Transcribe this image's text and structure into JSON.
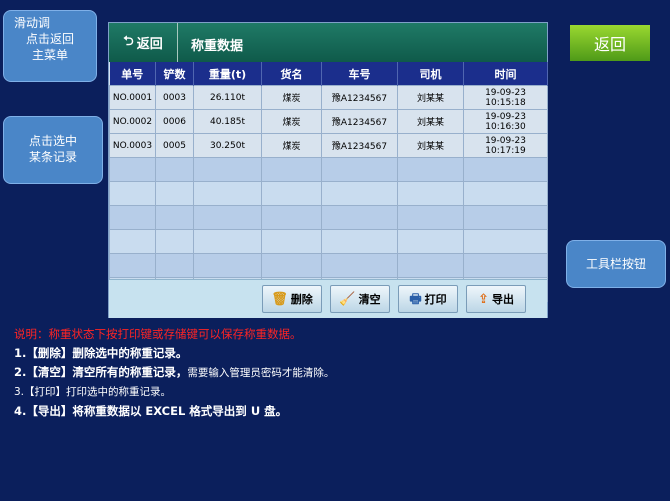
{
  "header": {
    "back_label": "返回",
    "title": "称重数据"
  },
  "right_button": {
    "label": "返回"
  },
  "table": {
    "columns": [
      "单号",
      "铲数",
      "重量(t)",
      "货名",
      "车号",
      "司机",
      "时间"
    ],
    "rows": [
      [
        "NO.0001",
        "0003",
        "26.110t",
        "煤炭",
        "豫A1234567",
        "刘某某",
        "19-09-23 10:15:18"
      ],
      [
        "NO.0002",
        "0006",
        "40.185t",
        "煤炭",
        "豫A1234567",
        "刘某某",
        "19-09-23 10:16:30"
      ],
      [
        "NO.0003",
        "0005",
        "30.250t",
        "煤炭",
        "豫A1234567",
        "刘某某",
        "19-09-23 10:17:19"
      ]
    ]
  },
  "toolbar": {
    "delete_label": "删除",
    "clear_label": "清空",
    "print_label": "打印",
    "export_label": "导出"
  },
  "bubbles": {
    "slide_line1": "滑动调",
    "slide_line2": "点击返回",
    "slide_line3": "主菜单",
    "select_line1": "点击选中",
    "select_line2": "某条记录",
    "toolbar_tip": "工具栏按钮"
  },
  "notes": {
    "intro": "说明：称重状态下按打印键或存储键可以保存称重数据。",
    "item1": "1.【删除】删除选中的称重记录。",
    "item2_a": "2.【清空】清空所有的称重记录，",
    "item2_b": "需要输入管理员密码才能清除。",
    "item3": "3.【打印】打印选中的称重记录。",
    "item4": "4.【导出】将称重数据以 EXCEL 格式导出到 U 盘。"
  }
}
